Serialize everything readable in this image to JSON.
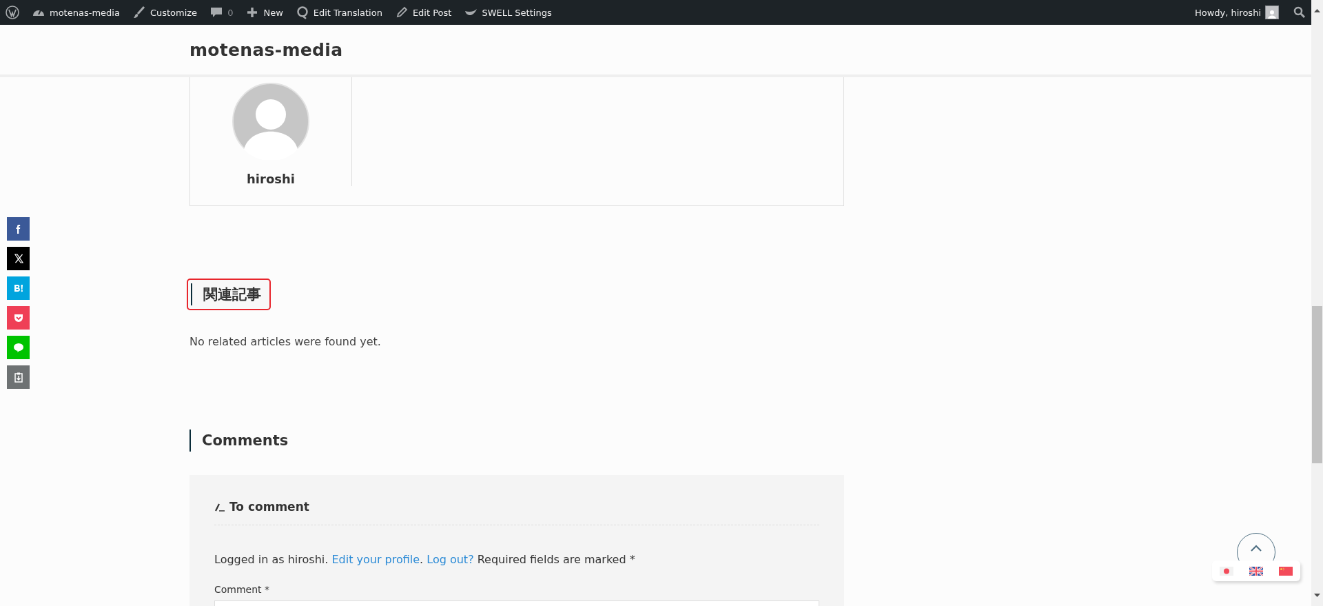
{
  "admin_bar": {
    "items": [
      {
        "kind": "wordpress"
      },
      {
        "kind": "dashboard",
        "label": "motenas-media"
      },
      {
        "kind": "brush",
        "label": "Customize"
      },
      {
        "kind": "comments",
        "label": "0"
      },
      {
        "kind": "plus",
        "label": "New"
      },
      {
        "kind": "translate",
        "label": "Edit Translation"
      },
      {
        "kind": "pencil",
        "label": "Edit Post"
      },
      {
        "kind": "swell",
        "label": "SWELL Settings"
      }
    ],
    "greeting": "Howdy, hiroshi"
  },
  "header": {
    "site_title": "motenas-media"
  },
  "author_box": {
    "name": "hiroshi"
  },
  "related": {
    "heading": "関連記事",
    "highlighted": true,
    "empty_text": "No related articles were found yet."
  },
  "comments": {
    "heading": "Comments",
    "form": {
      "title": "To comment",
      "note": [
        {
          "kind": "text",
          "text": "Logged in as hiroshi. "
        },
        {
          "kind": "link",
          "text": "Edit your profile"
        },
        {
          "kind": "text",
          "text": ". "
        },
        {
          "kind": "link",
          "text": "Log out?"
        },
        {
          "kind": "text",
          "text": " Required fields are marked *"
        }
      ],
      "comment_label": "Comment *"
    }
  },
  "share_buttons": [
    {
      "kind": "facebook"
    },
    {
      "kind": "x"
    },
    {
      "kind": "hatena"
    },
    {
      "kind": "pocket"
    },
    {
      "kind": "line"
    },
    {
      "kind": "copy"
    }
  ],
  "languages": [
    {
      "kind": "ja"
    },
    {
      "kind": "en"
    },
    {
      "kind": "zh"
    }
  ]
}
